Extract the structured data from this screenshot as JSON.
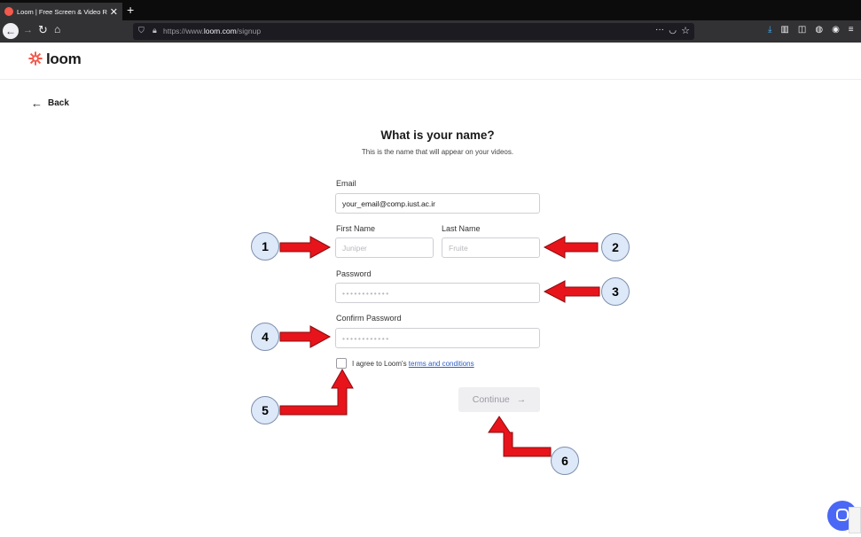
{
  "browser": {
    "tab_title": "Loom | Free Screen & Video Re",
    "tab_close": "✕",
    "new_tab": "+",
    "url_prefix": "https://www.",
    "url_domain": "loom.com",
    "url_path": "/signup",
    "url_more": "···"
  },
  "header": {
    "logo_text": "loom"
  },
  "nav": {
    "back_label": "Back"
  },
  "form": {
    "title": "What is your name?",
    "subtitle": "This is the name that will appear on your videos.",
    "email_label": "Email",
    "email_value": "your_email@comp.iust.ac.ir",
    "first_name_label": "First Name",
    "first_name_placeholder": "Juniper",
    "last_name_label": "Last Name",
    "last_name_placeholder": "Fruite",
    "password_label": "Password",
    "password_placeholder": "••••••••••••",
    "confirm_label": "Confirm Password",
    "confirm_placeholder": "••••••••••••",
    "agree_text": "I agree to Loom's ",
    "agree_link": "terms and conditions",
    "continue_label": "Continue",
    "continue_arrow": "→"
  },
  "annotations": [
    "1",
    "2",
    "3",
    "4",
    "5",
    "6"
  ],
  "colors": {
    "accent_arrow": "#e8141b",
    "marker_fill": "#dde8f8",
    "logo": "#f25a4d",
    "link": "#2f5ec4"
  }
}
